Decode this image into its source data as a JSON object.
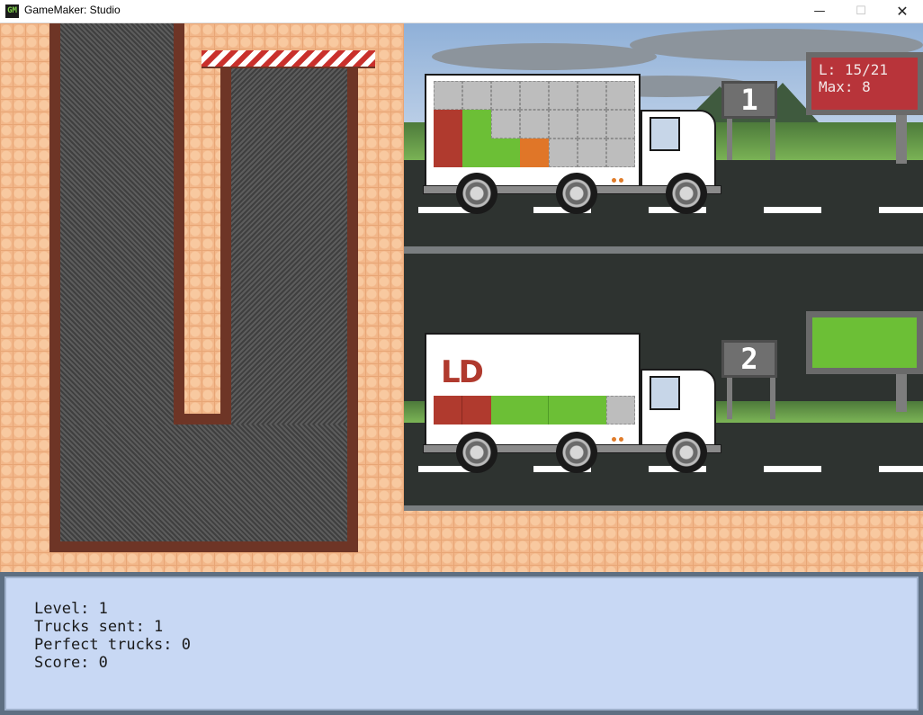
{
  "window": {
    "title": "GameMaker: Studio",
    "icon": "gamemaker-icon",
    "controls": {
      "minimize": "—",
      "maximize": "☐",
      "close": "✕"
    }
  },
  "trucks": [
    {
      "sign_number": "1",
      "cargo": [
        "red",
        "green",
        "green",
        "orange"
      ],
      "logo_visible": false
    },
    {
      "sign_number": "2",
      "logo_text": "LD",
      "cargo": [
        "red",
        "red",
        "green",
        "green",
        "green",
        "green",
        "gray"
      ],
      "logo_visible": true
    }
  ],
  "scoreboard": {
    "level_load": "L: 15/21",
    "max": "Max:  8"
  },
  "stats": {
    "level": "Level: 1",
    "trucks_sent": "Trucks sent: 1",
    "perfect_trucks": "Perfect trucks: 0",
    "score": "Score: 0"
  },
  "colors": {
    "cargo_red": "#b03a2e",
    "cargo_green": "#6cbf36",
    "cargo_orange": "#e07628",
    "scoreboard_bg": "#b8343a",
    "green_board": "#6cbf36",
    "info_panel": "#c8d8f4"
  }
}
